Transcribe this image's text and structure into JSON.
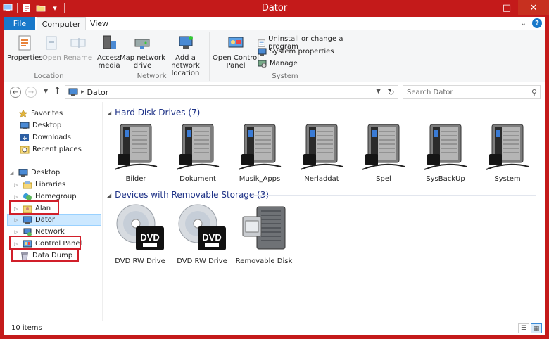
{
  "window": {
    "title": "Dator",
    "accent_color": "#c41a1a",
    "file_tab_color": "#1979ca"
  },
  "quick_access": [
    "properties-icon",
    "new-folder-icon",
    "customize-icon"
  ],
  "tabs": [
    {
      "label": "File"
    },
    {
      "label": "Computer"
    },
    {
      "label": "View"
    }
  ],
  "ribbon": {
    "location": {
      "label": "Location",
      "properties": "Properties",
      "open": "Open",
      "rename": "Rename"
    },
    "network": {
      "label": "Network",
      "access_media_1": "Access",
      "access_media_2": "media",
      "map_drive_1": "Map network",
      "map_drive_2": "drive",
      "add_location_1": "Add a network",
      "add_location_2": "location"
    },
    "system": {
      "label": "System",
      "control_panel_1": "Open Control",
      "control_panel_2": "Panel",
      "uninstall": "Uninstall or change a program",
      "system_properties": "System properties",
      "manage": "Manage"
    }
  },
  "address": {
    "path": "Dator",
    "search_placeholder": "Search Dator"
  },
  "nav": {
    "favorites": "Favorites",
    "desktop_fav": "Desktop",
    "downloads": "Downloads",
    "recent": "Recent places",
    "desktop": "Desktop",
    "libraries": "Libraries",
    "homegroup": "Homegroup",
    "alan": "Alan",
    "dator": "Dator",
    "network": "Network",
    "control_panel": "Control Panel",
    "data_dump": "Data Dump"
  },
  "sections": {
    "hdd": "Hard Disk Drives (7)",
    "removable": "Devices with Removable Storage (3)"
  },
  "hard_drives": [
    "Bilder",
    "Dokument",
    "Musik_Apps",
    "Nerladdat",
    "Spel",
    "SysBackUp",
    "System"
  ],
  "removable_devices": [
    {
      "label": "DVD RW Drive",
      "icon": "dvd-icon"
    },
    {
      "label": "DVD RW Drive",
      "icon": "dvd-icon"
    },
    {
      "label": "Removable Disk",
      "icon": "usb-drive-icon"
    }
  ],
  "status": {
    "items": "10 items"
  }
}
